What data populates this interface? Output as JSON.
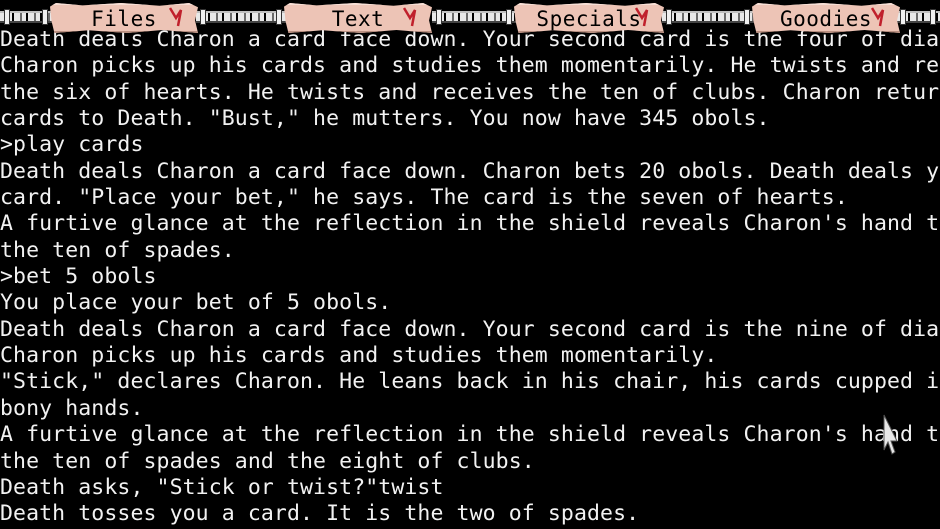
{
  "menu": {
    "files": "Files",
    "text": "Text",
    "specials": "Specials",
    "goodies": "Goodies"
  },
  "transcript": [
    "Death deals Charon a card face down. Your second card is the four of diamonds.",
    "Charon picks up his cards and studies them momentarily. He twists and receives",
    "the six of hearts. He twists and receives the ten of clubs. Charon returns his",
    "cards to Death. \"Bust,\" he mutters. You now have 345 obols.",
    ">play cards",
    "Death deals Charon a card face down. Charon bets 20 obols. Death deals you a",
    "card. \"Place your bet,\" he says. The card is the seven of hearts.",
    "A furtive glance at the reflection in the shield reveals Charon's hand to be",
    "the ten of spades.",
    ">bet 5 obols",
    "You place your bet of 5 obols.",
    "Death deals Charon a card face down. Your second card is the nine of diamonds.",
    "Charon picks up his cards and studies them momentarily.",
    "\"Stick,\" declares Charon. He leans back in his chair, his cards cupped in his",
    "bony hands.",
    "A furtive glance at the reflection in the shield reveals Charon's hand to be",
    "the ten of spades and the eight of clubs.",
    "Death asks, \"Stick or twist?\"twist",
    "Death tosses you a card. It is the two of spades."
  ],
  "colors": {
    "background": "#000000",
    "text": "#f2f2f2",
    "menu_scroll": "#edc4b6",
    "menu_tick": "#c0202c"
  },
  "icons": {
    "menu_decoration": "chain-icon",
    "menu_mark": "red-tick-icon",
    "pointer": "arrow-cursor-icon"
  }
}
